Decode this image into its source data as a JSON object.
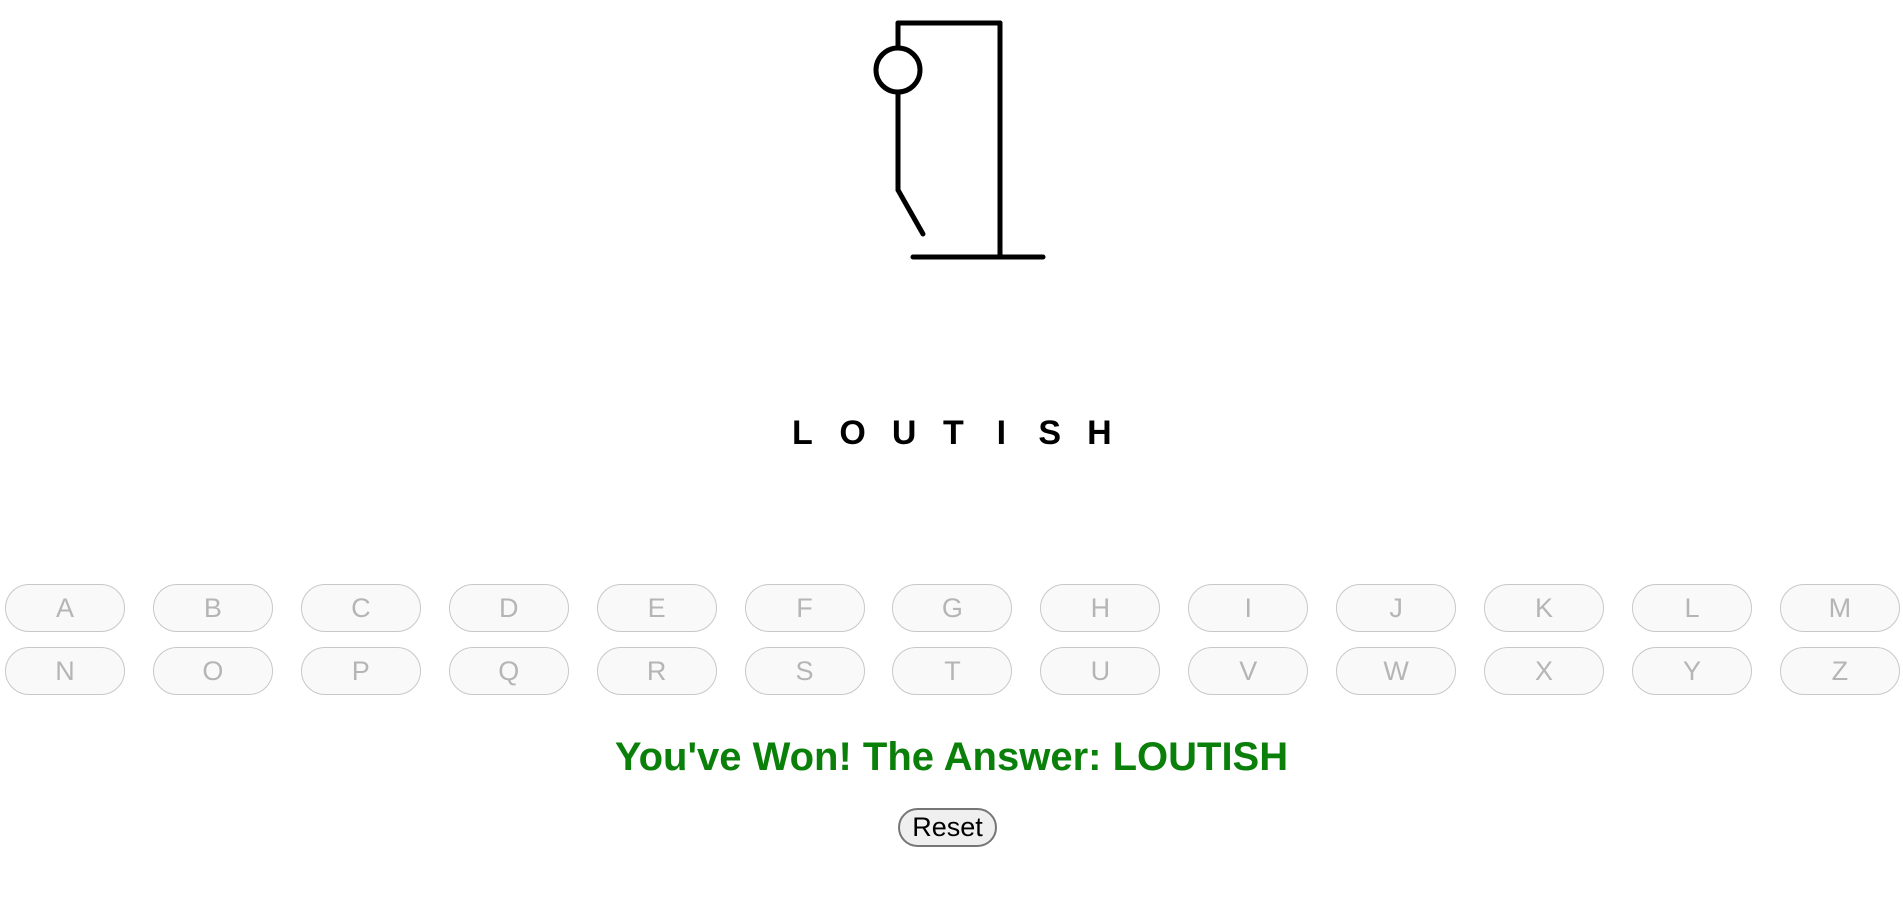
{
  "gallows": {
    "stroke_color": "#000000"
  },
  "word": {
    "letters": [
      "L",
      "O",
      "U",
      "T",
      "I",
      "S",
      "H"
    ]
  },
  "keyboard": {
    "row1": [
      "A",
      "B",
      "C",
      "D",
      "E",
      "F",
      "G",
      "H",
      "I",
      "J",
      "K",
      "L",
      "M"
    ],
    "row2": [
      "N",
      "O",
      "P",
      "Q",
      "R",
      "S",
      "T",
      "U",
      "V",
      "W",
      "X",
      "Y",
      "Z"
    ],
    "state": "disabled"
  },
  "message": {
    "text": "You've Won! The Answer: LOUTISH",
    "color": "#0a800a"
  },
  "reset": {
    "label": "Reset"
  }
}
